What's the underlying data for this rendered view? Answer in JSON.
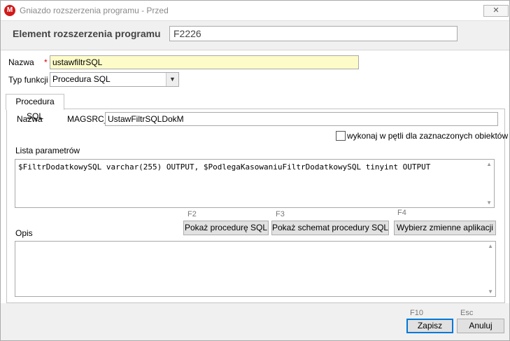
{
  "window": {
    "title": "Gniazdo rozszerzenia programu - Przed",
    "close_glyph": "✕"
  },
  "header": {
    "label": "Element rozszerzenia programu",
    "code": "F2226"
  },
  "form": {
    "nazwa_label": "Nazwa",
    "required_mark": "*",
    "nazwa_value": "ustawfiltrSQL",
    "typ_label": "Typ funkcji",
    "typ_value": "Procedura SQL",
    "typ_arrow": "▼"
  },
  "tab": {
    "label": "Procedura SQL"
  },
  "procedure": {
    "nazwa_label": "Nazwa",
    "prefix": "MAGSRC_",
    "name_value": "UstawFiltrSQLDokM",
    "loop_checkbox_label": "wykonaj w pętli dla zaznaczonych obiektów",
    "loop_checked": false,
    "params_label": "Lista parametrów",
    "params_value": "$FiltrDodatkowySQL varchar(255) OUTPUT, $PodlegaKasowaniuFiltrDodatkowySQL tinyint OUTPUT",
    "opis_label": "Opis",
    "opis_value": ""
  },
  "actions": {
    "show_proc": {
      "key": "F2",
      "label": "Pokaż procedurę SQL"
    },
    "show_schema": {
      "key": "F3",
      "label": "Pokaż schemat procedury SQL"
    },
    "select_vars": {
      "key": "F4",
      "label": "Wybierz zmienne aplikacji"
    }
  },
  "footer": {
    "save": {
      "key": "F10",
      "label": "Zapisz"
    },
    "cancel": {
      "key": "Esc",
      "label": "Anuluj"
    }
  },
  "scroll": {
    "up": "▲",
    "down": "▼"
  },
  "colors": {
    "required_field_bg": "#fdfcc9",
    "app_icon": "#d11a1a",
    "primary_border": "#0078d7"
  }
}
